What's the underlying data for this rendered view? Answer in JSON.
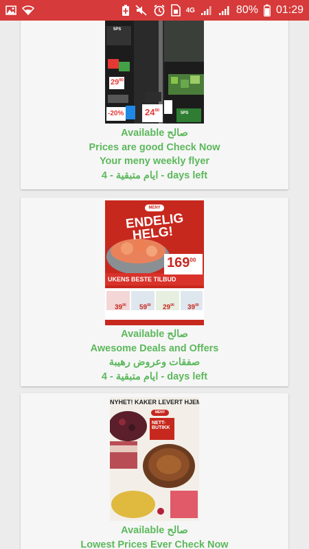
{
  "status_bar": {
    "network": "4G",
    "battery": "80%",
    "time": "01:29"
  },
  "flyer1": {
    "lines": [
      "Available صالح",
      "Prices are good Check Now",
      "Your meny weekly flyer",
      "ايام متبقية - 4 - days left"
    ],
    "texts": [
      "5PS",
      "29",
      "90",
      "-20%",
      "24",
      "90",
      "5PS"
    ]
  },
  "flyer2": {
    "lines": [
      "Available صالح",
      "Awesome Deals and Offers",
      "صفقات وعروض رهيبة",
      "ايام متبقية - 4 - days left"
    ],
    "brand": "MENY",
    "headline1": "ENDELIG",
    "headline2": "HELG!",
    "price": "169",
    "price_cents": "00",
    "banner": "UKENS BESTE TILBUD",
    "small_prices": [
      "39",
      "59",
      "29",
      "39"
    ],
    "small_cents": "90"
  },
  "flyer3": {
    "lines": [
      "Available صالح",
      "Lowest Prices Ever Check Now"
    ],
    "header": "NYHET! KAKER LEVERT HJEM",
    "brand": "MENY",
    "badge1": "NETT-",
    "badge2": "BUTIKK"
  }
}
